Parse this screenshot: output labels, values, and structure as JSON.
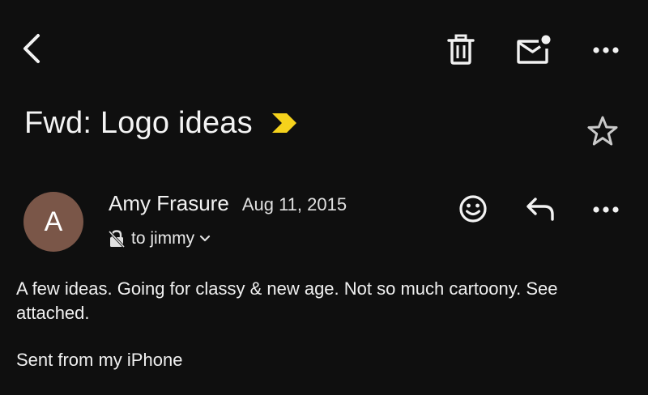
{
  "toolbar": {
    "back_icon": "chevron-left-icon",
    "delete_icon": "trash-icon",
    "mark_unread_icon": "mail-unread-icon",
    "more_icon": "more-horizontal-icon"
  },
  "email": {
    "subject": "Fwd: Logo ideas",
    "importance_color": "#f5d21c",
    "starred": false,
    "sender": {
      "name": "Amy Frasure",
      "avatar_initial": "A",
      "avatar_color": "#7a5648",
      "date": "Aug 11, 2015"
    },
    "recipient": "to jimmy",
    "body": "A few ideas. Going for classy & new age. Not so much cartoony. See attached.",
    "signature": "Sent from my iPhone"
  },
  "message_actions": {
    "react_icon": "emoji-icon",
    "reply_icon": "reply-icon",
    "more_icon": "more-horizontal-icon"
  },
  "colors": {
    "background": "#0f0f0f",
    "text": "#f2f2f2"
  }
}
